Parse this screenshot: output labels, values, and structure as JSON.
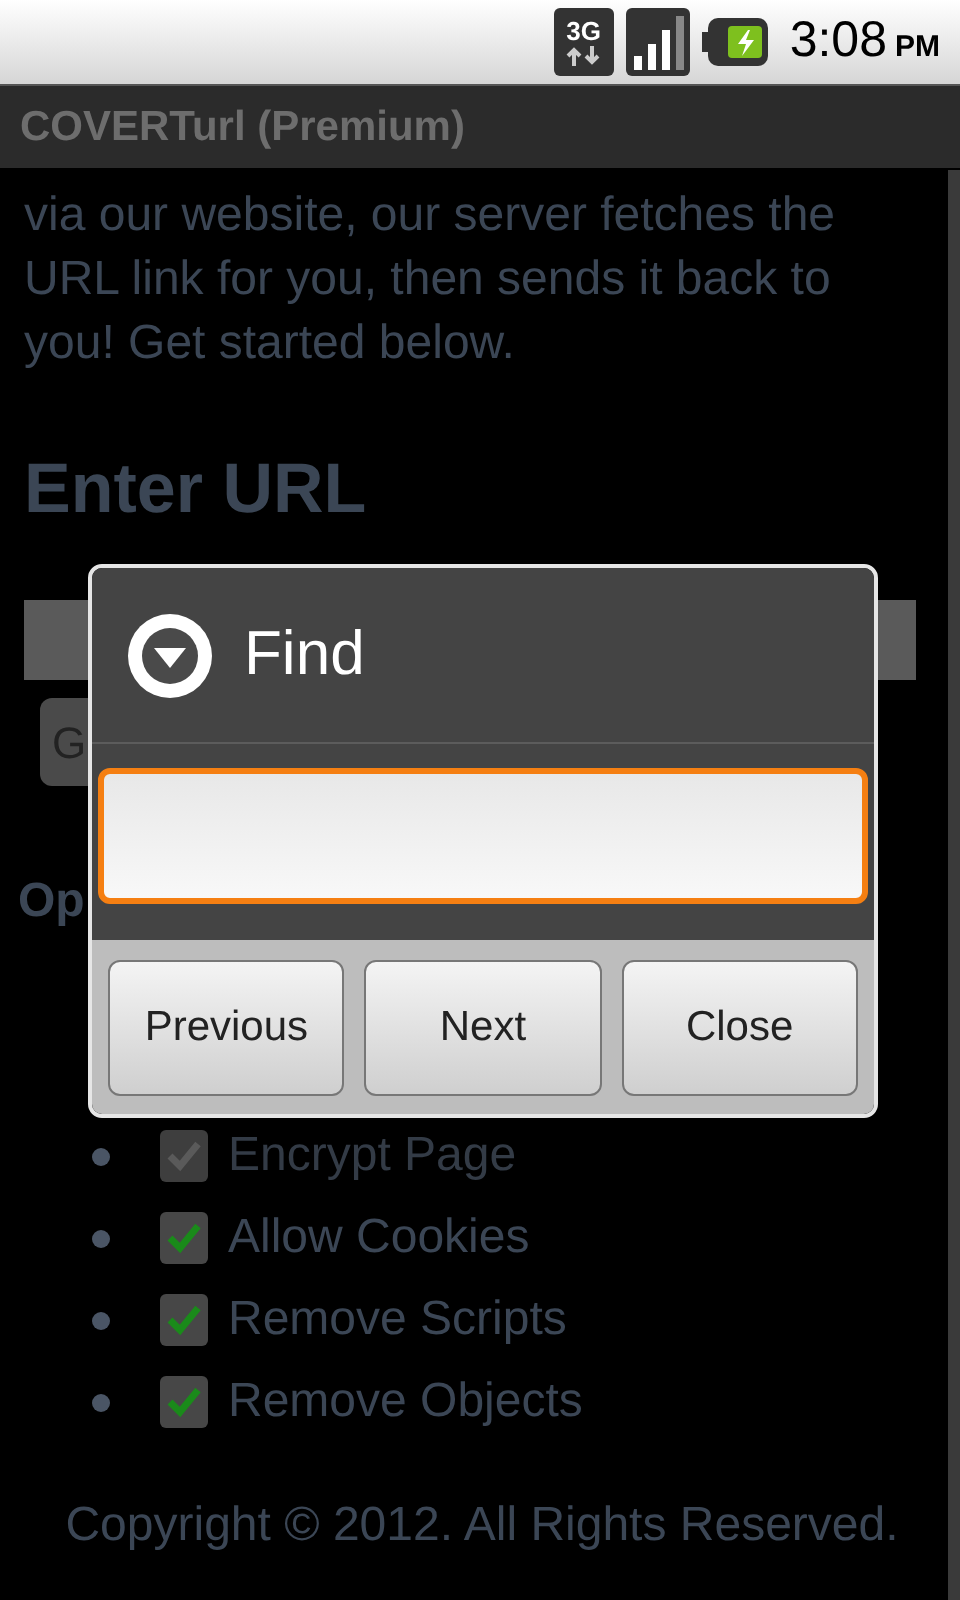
{
  "status_bar": {
    "network": "3G",
    "time": "3:08",
    "ampm": "PM"
  },
  "title_bar": {
    "title": "COVERTurl (Premium)"
  },
  "page": {
    "intro": "via our website, our server fetches the URL link for you, then sends it back to you! Get started below.",
    "heading": "Enter URL",
    "go_button": "G",
    "options_heading": "Op",
    "options": [
      {
        "label": "Encrypt Page",
        "checked": true,
        "disabled": true
      },
      {
        "label": "Allow Cookies",
        "checked": true,
        "disabled": false
      },
      {
        "label": "Remove Scripts",
        "checked": true,
        "disabled": false
      },
      {
        "label": "Remove Objects",
        "checked": true,
        "disabled": false
      }
    ],
    "footer": "Copyright © 2012. All Rights Reserved."
  },
  "dialog": {
    "title": "Find",
    "field": {
      "focused": true
    },
    "buttons": [
      "Previous",
      "Next",
      "Close"
    ]
  }
}
